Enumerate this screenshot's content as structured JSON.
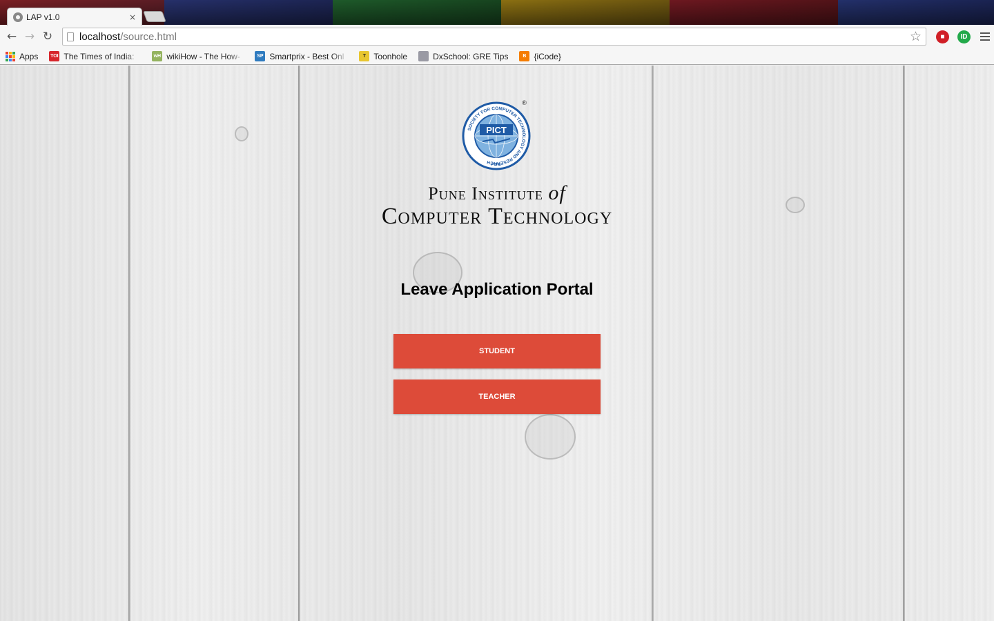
{
  "browser": {
    "tab_title": "LAP v1.0",
    "tab_close": "×",
    "url_host": "localhost",
    "url_path": "/source.html",
    "extension_badge": "ID",
    "bookmarks": [
      {
        "label": "Apps",
        "icon": "apps-grid-icon"
      },
      {
        "label": "The Times of India:",
        "icon": "toi-icon",
        "icon_text": "TOI",
        "color": "#d7262c"
      },
      {
        "label": "wikiHow - The How-",
        "icon": "wikihow-icon",
        "icon_text": "wH",
        "color": "#94b35f"
      },
      {
        "label": "Smartprix - Best Onl",
        "icon": "smartprix-icon",
        "icon_text": "SP",
        "color": "#2f7bbf"
      },
      {
        "label": "Toonhole",
        "icon": "toonhole-icon",
        "icon_text": "T",
        "color": "#e8c630"
      },
      {
        "label": "DxSchool: GRE Tips",
        "icon": "dxschool-icon",
        "icon_text": "",
        "color": "#9a9aa4"
      },
      {
        "label": "{iCode}",
        "icon": "blogger-icon",
        "icon_text": "B",
        "color": "#f57d00"
      }
    ]
  },
  "page": {
    "logo_text": "PICT",
    "logo_ring_text": "SOCIETY FOR COMPUTER TECHNOLOGY AND RESEARCH",
    "logo_bottom_text": "PUNE",
    "logo_registered": "®",
    "institute_line1_a": "Pune Institute",
    "institute_line1_of": "of",
    "institute_line2": "Computer Technology",
    "portal_title": "Leave Application Portal",
    "student_button": "STUDENT",
    "teacher_button": "TEACHER"
  },
  "colors": {
    "button": "#dd4b39",
    "logo_blue": "#1f5ba6"
  }
}
